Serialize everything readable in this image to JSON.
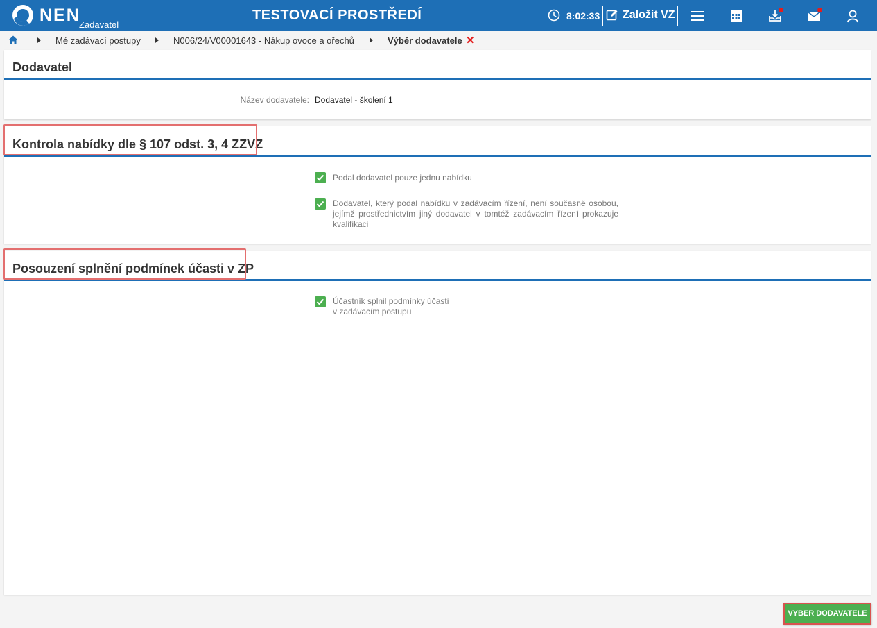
{
  "header": {
    "logo_text": "NEN",
    "logo_subtitle": "Zadavatel",
    "environment_title": "TESTOVACÍ PROSTŘEDÍ",
    "session_time": "8:02:33",
    "create_label": "Založit VZ",
    "icons": [
      "clock-icon",
      "edit-icon",
      "menu-icon",
      "calendar-icon",
      "inbox-icon",
      "mail-icon",
      "user-icon"
    ],
    "notification_color": "#e31d1d",
    "brand_color": "#1e6fb6"
  },
  "breadcrumb": {
    "items": [
      {
        "label": "Mé zadávací postupy"
      },
      {
        "label": "N006/24/V00001643 - Nákup ovoce a ořechů"
      },
      {
        "label": "Výběr dodavatele"
      }
    ],
    "close_glyph": "✕"
  },
  "supplier_panel": {
    "title": "Dodavatel",
    "name_label": "Název dodavatele:",
    "name_value": "Dodavatel - školení 1"
  },
  "offer_check_panel": {
    "title": "Kontrola nabídky dle § 107 odst. 3, 4 ZZVZ",
    "items": [
      {
        "label": "Podal dodavatel pouze jednu nabídku",
        "checked": true
      },
      {
        "label": "Dodavatel, který podal nabídku v zadávacím řízení, není současně osobou, jejímž prostřednictvím jiný dodavatel v tomtéž zadávacím řízení prokazuje kvalifikaci",
        "checked": true
      }
    ]
  },
  "conditions_panel": {
    "title": "Posouzení splnění podmínek účasti v ZP",
    "items": [
      {
        "label_line1": "Účastník splnil podmínky účasti",
        "label_line2": "v zadávacím postupu",
        "checked": true
      }
    ]
  },
  "actions": {
    "submit_label": "VYBER DODAVATELE",
    "submit_color": "#4caf50"
  }
}
